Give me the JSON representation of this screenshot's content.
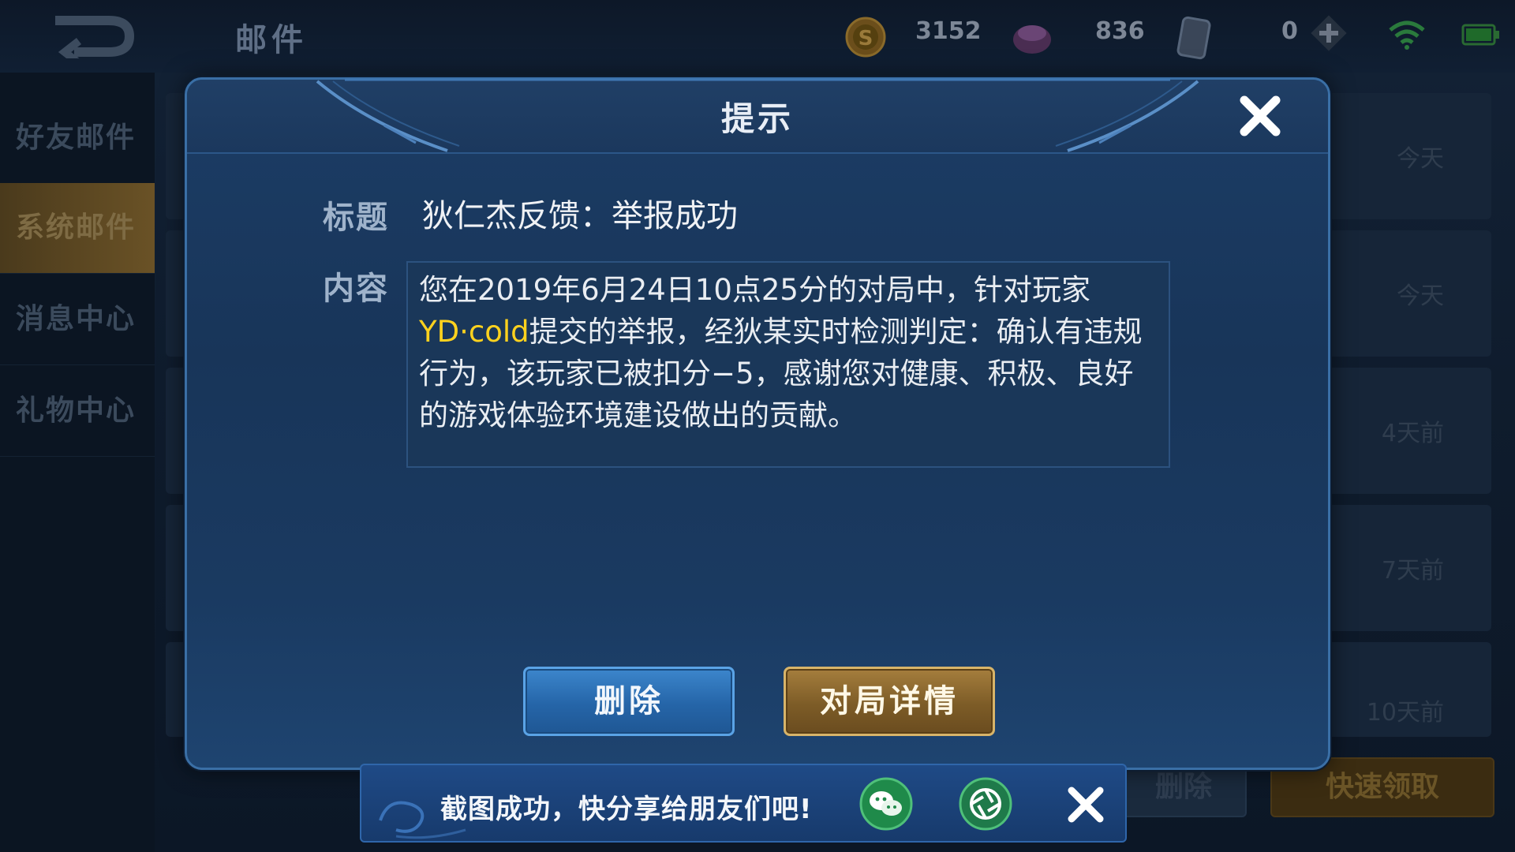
{
  "topbar": {
    "title": "邮件",
    "gold": "3152",
    "gems": "836",
    "vouchers": "0"
  },
  "sidebar": {
    "items": [
      {
        "label": "好友邮件"
      },
      {
        "label": "系统邮件"
      },
      {
        "label": "消息中心"
      },
      {
        "label": "礼物中心"
      }
    ]
  },
  "mail_list": {
    "times": [
      "今天",
      "今天",
      "4天前",
      "7天前",
      "10天前"
    ],
    "delete_all_label": "删除",
    "quick_claim_label": "快速领取"
  },
  "dialog": {
    "title": "提示",
    "title_label": "标题",
    "content_label": "内容",
    "mail_title": "狄仁杰反馈：举报成功",
    "content": {
      "part1": "您在2019年6月24日10点25分的对局中，针对玩家",
      "player": "YD·cold",
      "part2": "提交的举报，经狄某实时检测判定：确认有违规行为，该玩家已被扣分−5，感谢您对健康、积极、良好的游戏体验环境建设做出的贡献。"
    },
    "delete_label": "删除",
    "detail_label": "对局详情"
  },
  "toast": {
    "text": "截图成功，快分享给朋友们吧!"
  },
  "colors": {
    "highlight": "#ffd21e",
    "dialog_bg": "#1a3a61",
    "gold_button": "#7d5c27",
    "blue_button": "#2565a8"
  }
}
